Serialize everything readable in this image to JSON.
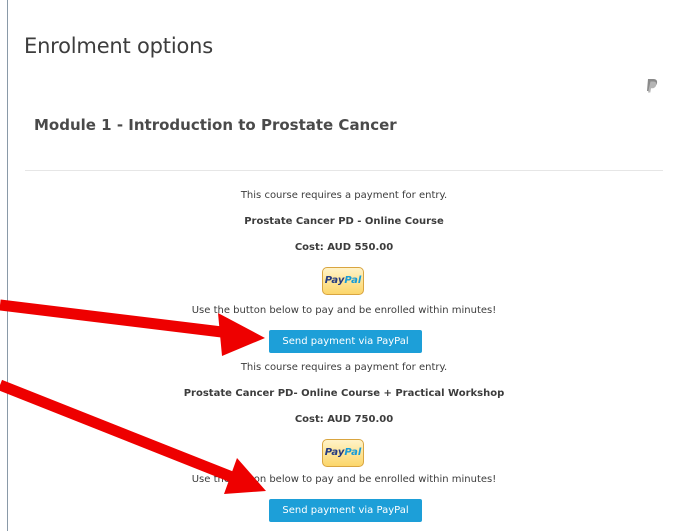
{
  "page": {
    "title": "Enrolment options",
    "module_title": "Module 1 - Introduction to Prostate Cancer"
  },
  "icons": {
    "paypal_small": "paypal-icon"
  },
  "enrolments": [
    {
      "requirement_text": "This course requires a payment for entry.",
      "course_name": "Prostate Cancer PD - Online Course",
      "cost": "Cost: AUD 550.00",
      "logo_pay": "Pay",
      "logo_pal": "Pal",
      "instruction": "Use the button below to pay and be enrolled within minutes!",
      "button_label": "Send payment via PayPal"
    },
    {
      "requirement_text": "This course requires a payment for entry.",
      "course_name": "Prostate Cancer PD- Online Course + Practical Workshop",
      "cost": "Cost: AUD 750.00",
      "logo_pay": "Pay",
      "logo_pal": "Pal",
      "instruction": "Use the button below to pay and be enrolled within minutes!",
      "button_label": "Send payment via PayPal"
    }
  ],
  "colors": {
    "button_bg": "#1d9fd8",
    "annotation_arrow": "#ee0000"
  }
}
